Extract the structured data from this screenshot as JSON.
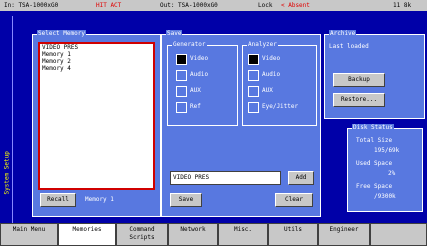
{
  "topbar": {
    "in_label": "In: TSA-1000xG0",
    "in_status": "HIT ACT",
    "out_label": "Out: TSA-1000xG0",
    "lock_label": "Lock",
    "lock_status": "< Absent",
    "right_text": "11 8k"
  },
  "side_label": "System Setup",
  "memory": {
    "legend": "Select Memory",
    "items": [
      "VIDEO PRES",
      "Memory 1",
      "Memory 2",
      "Memory 4"
    ],
    "recall_label": "Recall",
    "current_label": "Memory 1"
  },
  "save": {
    "legend": "Save",
    "generator_legend": "Generator",
    "analyzer_legend": "Analyzer",
    "generator": [
      {
        "label": "Video",
        "checked": true
      },
      {
        "label": "Audio",
        "checked": false
      },
      {
        "label": "AUX",
        "checked": false
      },
      {
        "label": "Ref",
        "checked": false
      }
    ],
    "analyzer": [
      {
        "label": "Video",
        "checked": true
      },
      {
        "label": "Audio",
        "checked": false
      },
      {
        "label": "AUX",
        "checked": false
      },
      {
        "label": "Eye/Jitter",
        "checked": false
      }
    ],
    "name_value": "VIDEO PRES",
    "add_label": "Add",
    "save_label": "Save",
    "clear_label": "Clear"
  },
  "archive": {
    "legend": "Archive",
    "last_loaded": "Last loaded",
    "backup_label": "Backup",
    "restore_label": "Restore..."
  },
  "disk": {
    "legend": "Disk Status",
    "total_label": "Total Size",
    "total_value": "195/69k",
    "used_label": "Used Space",
    "used_value": "2%",
    "free_label": "Free Space",
    "free_value": "/9300k"
  },
  "tabs": [
    "Main Menu",
    "Memories",
    "Command Scripts",
    "Network",
    "Misc.",
    "Utils",
    "Engineer"
  ],
  "colors": {
    "background": "#0000a8",
    "panel": "#5878e0",
    "highlight": "#e00000"
  }
}
